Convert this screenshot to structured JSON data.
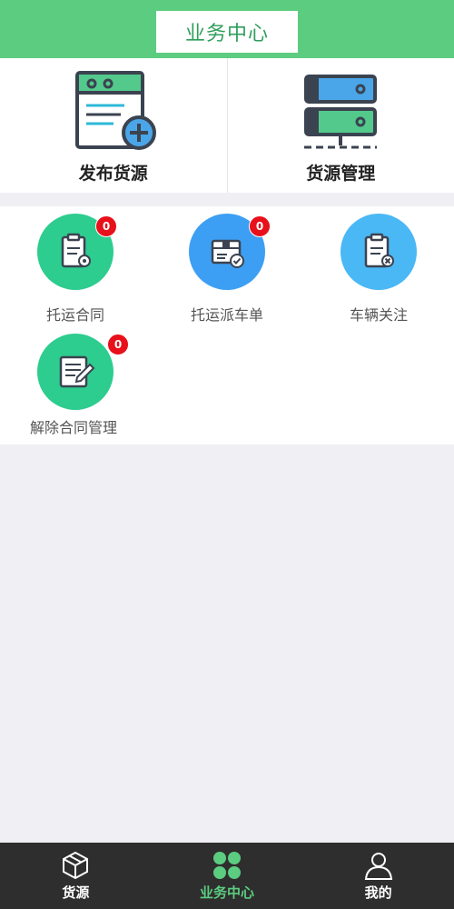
{
  "header": {
    "title": "业务中心"
  },
  "top_actions": [
    {
      "label": "发布货源",
      "icon": "publish-document-plus-icon"
    },
    {
      "label": "货源管理",
      "icon": "server-stack-icon"
    }
  ],
  "grid_items": [
    {
      "label": "托运合同",
      "badge": "0",
      "icon": "clipboard-badge-icon",
      "color": "#2dcc8f"
    },
    {
      "label": "托运派车单",
      "badge": "0",
      "icon": "box-check-icon",
      "color": "#3d9ff3"
    },
    {
      "label": "车辆关注",
      "icon": "clipboard-x-icon",
      "color": "#4ab8f5"
    },
    {
      "label": "解除合同管理",
      "badge": "0",
      "icon": "document-edit-icon",
      "color": "#2dcc8f"
    }
  ],
  "tabbar": [
    {
      "label": "货源",
      "icon": "cube-icon"
    },
    {
      "label": "业务中心",
      "icon": "four-dots-icon",
      "active": true
    },
    {
      "label": "我的",
      "icon": "user-icon"
    }
  ],
  "colors": {
    "brand_green": "#5ccc80",
    "badge_red": "#e8101a",
    "tabbar_bg": "#2e2e2e"
  }
}
